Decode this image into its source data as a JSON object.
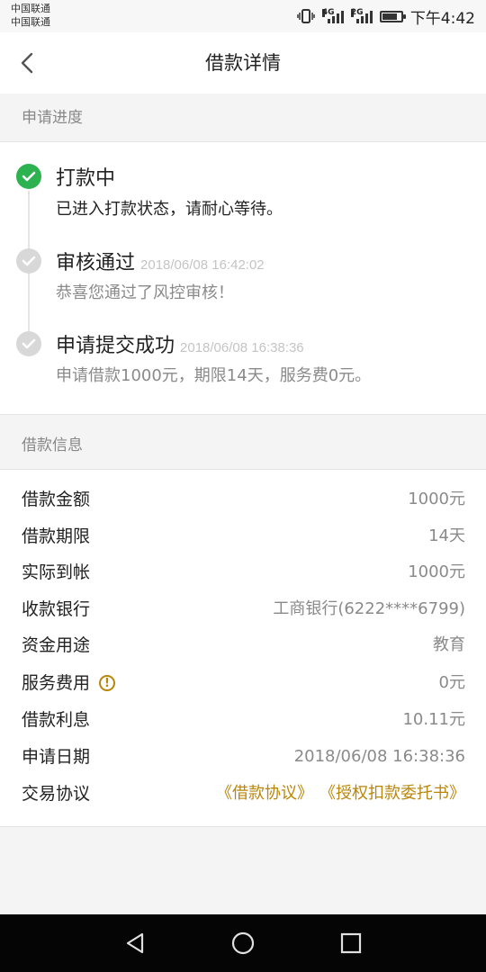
{
  "status_bar": {
    "carrier_1": "中国联通",
    "carrier_2": "中国联通",
    "net_1": "4G",
    "net_2": "2G",
    "time": "下午4:42"
  },
  "header": {
    "title": "借款详情",
    "back_icon": "chevron-left-icon"
  },
  "progress": {
    "section_title": "申请进度",
    "steps": [
      {
        "title": "打款中",
        "time": "",
        "desc": "已进入打款状态，请耐心等待。",
        "state": "active"
      },
      {
        "title": "审核通过",
        "time": "2018/06/08 16:42:02",
        "desc": "恭喜您通过了风控审核！",
        "state": "done"
      },
      {
        "title": "申请提交成功",
        "time": "2018/06/08 16:38:36",
        "desc": "申请借款1000元，期限14天，服务费0元。",
        "state": "done"
      }
    ]
  },
  "loan_info": {
    "section_title": "借款信息",
    "rows": [
      {
        "label": "借款金额",
        "value": "1000元"
      },
      {
        "label": "借款期限",
        "value": "14天"
      },
      {
        "label": "实际到帐",
        "value": "1000元"
      },
      {
        "label": "收款银行",
        "value": "工商银行(6222****6799)"
      },
      {
        "label": "资金用途",
        "value": "教育"
      },
      {
        "label": "服务费用",
        "value": "0元",
        "hint_icon": "!"
      },
      {
        "label": "借款利息",
        "value": "10.11元"
      },
      {
        "label": "申请日期",
        "value": "2018/06/08 16:38:36"
      },
      {
        "label": "交易协议",
        "links": [
          "《借款协议》",
          "《授权扣款委托书》"
        ]
      }
    ]
  },
  "colors": {
    "accent_gold": "#b8860b",
    "success_green": "#2cb34f",
    "inactive_gray": "#d8d8d8"
  },
  "battery_level": 0.8
}
